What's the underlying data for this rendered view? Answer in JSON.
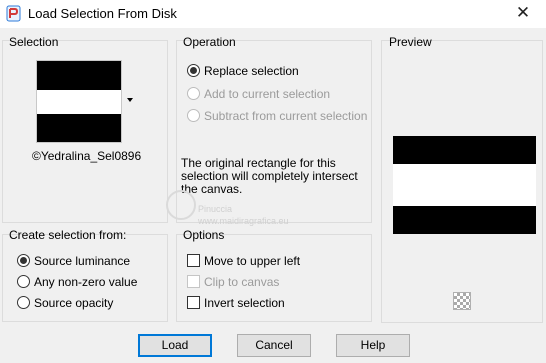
{
  "window": {
    "title": "Load Selection From Disk",
    "close_glyph": "✕"
  },
  "selection_group": {
    "label": "Selection",
    "file_name": "©Yedralina_Sel0896"
  },
  "operation_group": {
    "label": "Operation",
    "options": [
      "Replace selection",
      "Add to current selection",
      "Subtract from current selection"
    ],
    "selected": "Replace selection",
    "description": [
      "The original rectangle for this",
      "selection will completely intersect",
      "the canvas."
    ]
  },
  "preview_group": {
    "label": "Preview"
  },
  "create_from_group": {
    "label": "Create selection from:",
    "options": [
      "Source luminance",
      "Any non-zero value",
      "Source opacity"
    ],
    "selected": "Source luminance"
  },
  "options_group": {
    "label": "Options",
    "checkboxes": [
      {
        "label": "Move to upper left",
        "checked": false,
        "enabled": true
      },
      {
        "label": "Clip to canvas",
        "checked": false,
        "enabled": false
      },
      {
        "label": "Invert selection",
        "checked": false,
        "enabled": true
      }
    ]
  },
  "buttons": {
    "load": "Load",
    "cancel": "Cancel",
    "help": "Help"
  },
  "watermark": {
    "line1": "Pinuccia",
    "line2": "www.maidiragrafica.eu"
  },
  "icons": {
    "app": "psp-app-icon",
    "navigate": "checker-navigate-icon"
  },
  "colors": {
    "focus_border": "#0078d7",
    "window_bg": "#f0f0f0",
    "titlebar_bg": "#ffffff"
  }
}
